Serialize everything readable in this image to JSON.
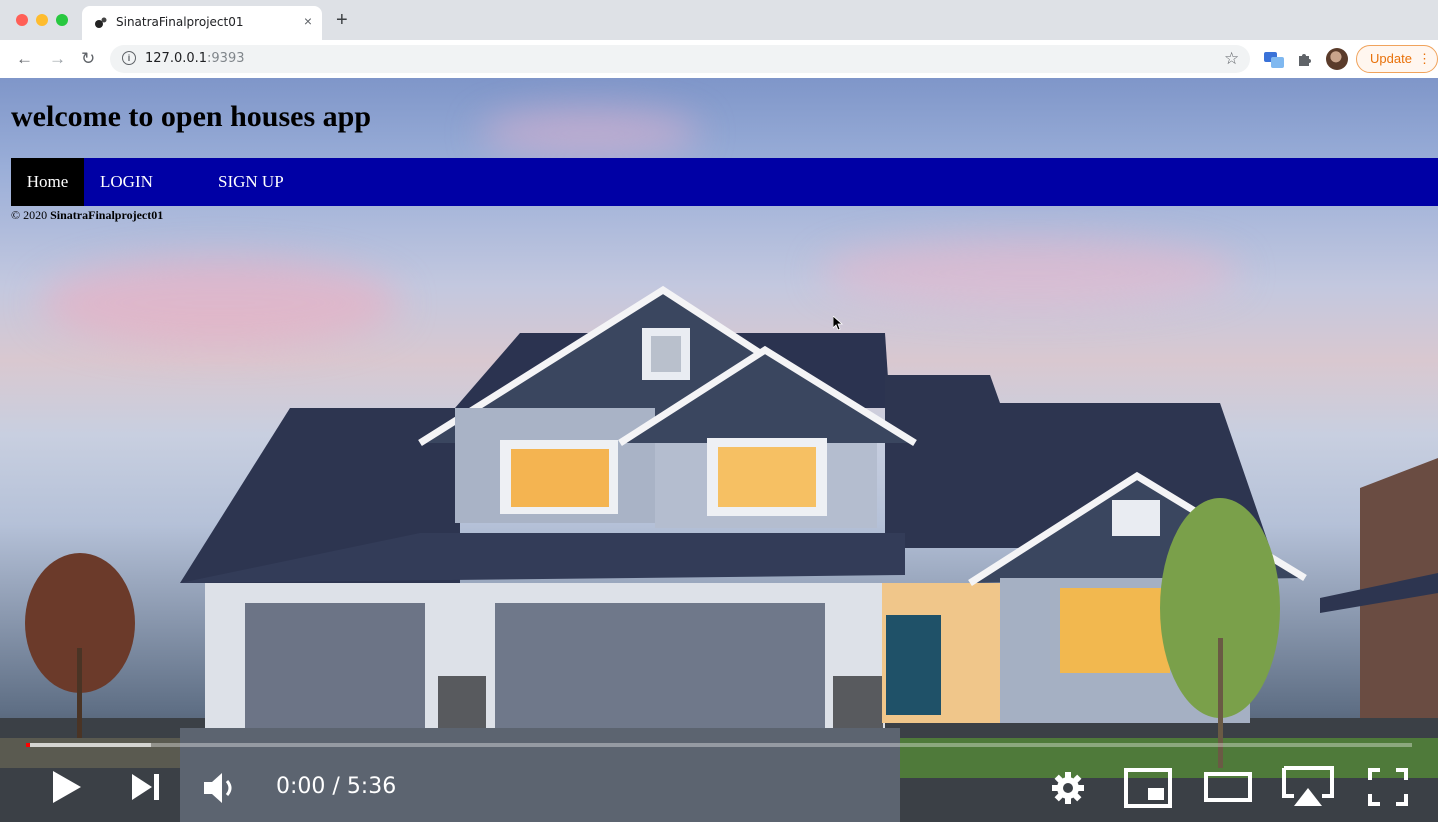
{
  "browser": {
    "tab_title": "SinatraFinalproject01",
    "tab_close": "×",
    "new_tab": "+",
    "url_host": "127.0.0.1",
    "url_port": ":9393",
    "update_label": "Update",
    "update_more": "⋮",
    "back": "←",
    "forward": "→",
    "reload": "↻",
    "star": "☆"
  },
  "page": {
    "heading": "welcome to open houses app",
    "nav": {
      "home": "Home",
      "login": "LOGIN",
      "signup": "SIGN UP"
    },
    "footer_prefix": "© 2020 ",
    "footer_name": "SinatraFinalproject01"
  },
  "video": {
    "time_current": "0:00",
    "time_total": "5:36",
    "progress_played": 0.0,
    "progress_buffered": 0.09
  },
  "colors": {
    "nav_bg": "#0000a5",
    "nav_active": "#000000",
    "progress_red": "#ff0000",
    "update_orange": "#e8710a"
  }
}
